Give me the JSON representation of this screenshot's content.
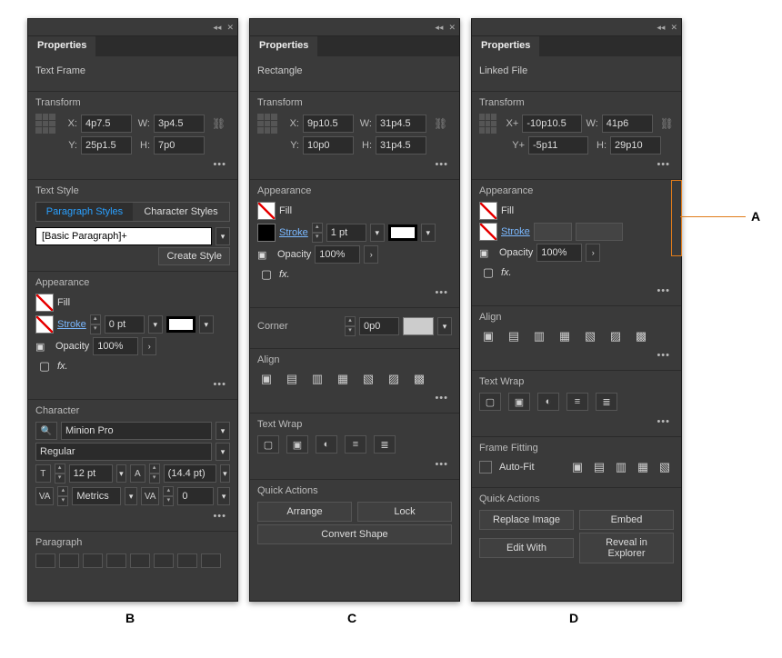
{
  "annotation": {
    "A": "A",
    "B": "B",
    "C": "C",
    "D": "D"
  },
  "tab_label": "Properties",
  "ellipsis": "•••",
  "labels": {
    "transform": "Transform",
    "text_frame": "Text Frame",
    "rectangle": "Rectangle",
    "linked_file": "Linked File",
    "text_style": "Text Style",
    "paragraph_styles": "Paragraph Styles",
    "character_styles": "Character Styles",
    "create_style": "Create Style",
    "appearance": "Appearance",
    "fill": "Fill",
    "stroke": "Stroke",
    "opacity": "Opacity",
    "character": "Character",
    "paragraph": "Paragraph",
    "corner": "Corner",
    "align": "Align",
    "text_wrap": "Text Wrap",
    "quick_actions": "Quick Actions",
    "frame_fitting": "Frame Fitting",
    "auto_fit": "Auto-Fit",
    "X": "X:",
    "Y": "Y:",
    "W": "W:",
    "H": "H:",
    "Xp": "X+",
    "Yp": "Y+"
  },
  "panelB": {
    "transform": {
      "x": "4p7.5",
      "y": "25p1.5",
      "w": "3p4.5",
      "h": "7p0"
    },
    "style_selected": "[Basic Paragraph]+",
    "appearance": {
      "stroke_pt": "0 pt",
      "opacity": "100%"
    },
    "character": {
      "font": "Minion Pro",
      "weight": "Regular",
      "size": "12 pt",
      "leading": "(14.4 pt)",
      "kerning": "Metrics",
      "tracking": "0"
    }
  },
  "panelC": {
    "transform": {
      "x": "9p10.5",
      "y": "10p0",
      "w": "31p4.5",
      "h": "31p4.5"
    },
    "appearance": {
      "stroke_pt": "1 pt",
      "opacity": "100%"
    },
    "corner": "0p0",
    "actions": {
      "arrange": "Arrange",
      "lock": "Lock",
      "convert": "Convert Shape"
    }
  },
  "panelD": {
    "transform": {
      "x": "-10p10.5",
      "y": "-5p11",
      "w": "41p6",
      "h": "29p10"
    },
    "appearance": {
      "opacity": "100%"
    },
    "actions": {
      "replace": "Replace Image",
      "embed": "Embed",
      "edit": "Edit With",
      "reveal": "Reveal in Explorer"
    }
  }
}
